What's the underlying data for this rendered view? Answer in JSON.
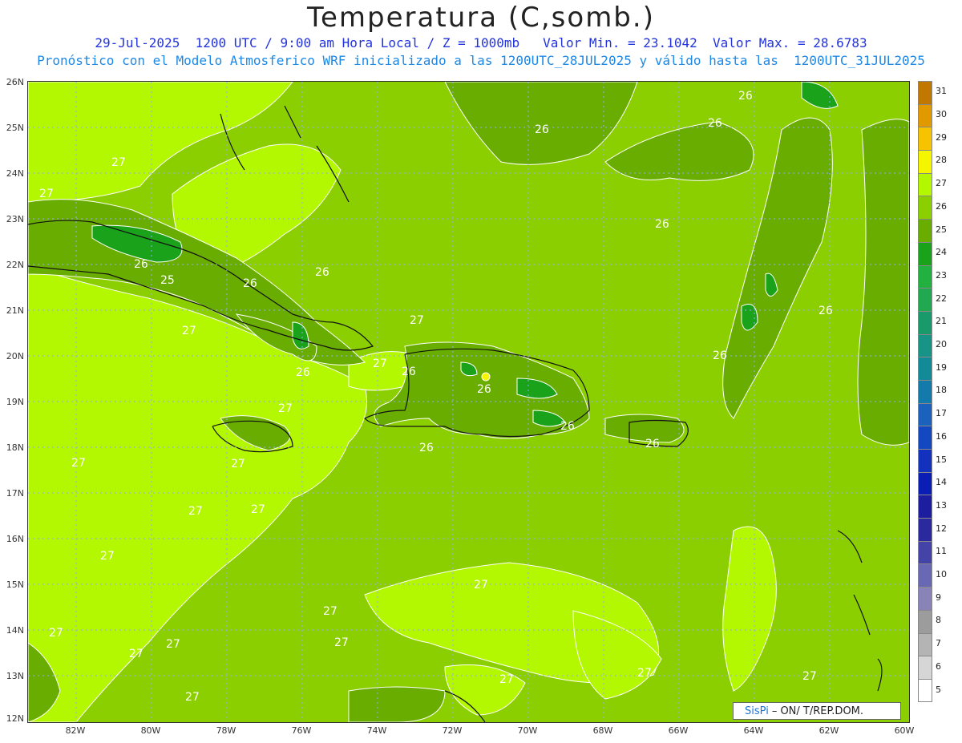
{
  "header": {
    "title": "Temperatura (C,somb.)",
    "line1": "29-Jul-2025  1200 UTC / 9:00 am Hora Local / Z = 1000mb   Valor Min. = 23.1042  Valor Max. = 28.6783",
    "line2": "Pronóstico con el Modelo Atmosferico WRF inicializado a las 1200UTC_28JUL2025 y válido hasta las  1200UTC_31JUL2025"
  },
  "axes": {
    "lat_labels": [
      "26N",
      "25N",
      "24N",
      "23N",
      "22N",
      "21N",
      "20N",
      "19N",
      "18N",
      "17N",
      "16N",
      "15N",
      "14N",
      "13N",
      "12N"
    ],
    "lon_labels": [
      "82W",
      "80W",
      "78W",
      "76W",
      "74W",
      "72W",
      "70W",
      "68W",
      "66W",
      "64W",
      "62W",
      "60W"
    ]
  },
  "colorbar": {
    "levels": [
      "31",
      "30",
      "29",
      "28",
      "27",
      "26",
      "25",
      "24",
      "23",
      "22",
      "21",
      "20",
      "19",
      "18",
      "17",
      "16",
      "15",
      "14",
      "13",
      "12",
      "11",
      "10",
      "9",
      "8",
      "7",
      "6",
      "5"
    ],
    "colors": [
      "#c07800",
      "#e09a00",
      "#f7c200",
      "#f5f500",
      "#b3f700",
      "#8ccf00",
      "#69ad00",
      "#1aa31a",
      "#22b040",
      "#23a852",
      "#1a9a6c",
      "#179485",
      "#138a98",
      "#137aab",
      "#1a62bb",
      "#1448c0",
      "#1232be",
      "#0a1eb5",
      "#1d1da0",
      "#2a2a9e",
      "#4343a8",
      "#6868b4",
      "#8a83b8",
      "#9c9c9c",
      "#b4b4b4",
      "#d6d6d6",
      "#ffffff"
    ]
  },
  "contour_labels": [
    "26",
    "27",
    "25"
  ],
  "logo": {
    "brand": "SisPi",
    "text": "– ON/   T/REP.DOM."
  }
}
